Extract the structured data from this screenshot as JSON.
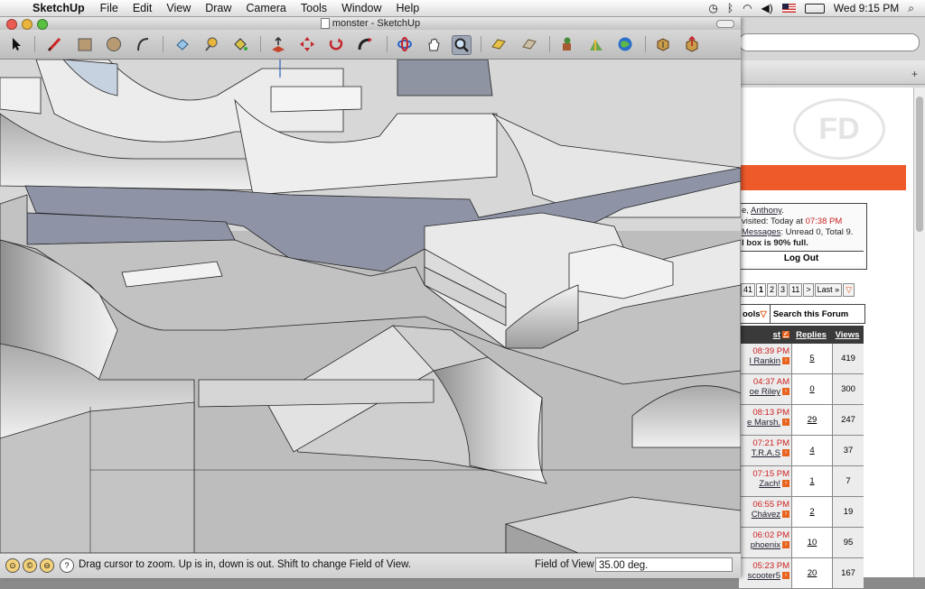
{
  "menubar": {
    "apple_glyph": "",
    "app_name": "SketchUp",
    "menus": [
      "File",
      "Edit",
      "View",
      "Draw",
      "Camera",
      "Tools",
      "Window",
      "Help"
    ],
    "clock": "Wed 9:15 PM"
  },
  "window": {
    "title": "monster - SketchUp"
  },
  "toolbar": {
    "tools": [
      "select-tool",
      "pencil-tool",
      "rectangle-tool",
      "circle-tool",
      "arc-tool",
      "eraser-tool",
      "tape-measure-tool",
      "paint-bucket-tool",
      "push-pull-tool",
      "move-tool",
      "rotate-tool",
      "follow-me-tool",
      "orbit-tool",
      "pan-tool",
      "zoom-tool",
      "section-plane-tool",
      "section-cut-tool",
      "add-location-tool",
      "toggle-terrain-tool",
      "google-earth-tool",
      "get-models-tool",
      "share-model-tool"
    ]
  },
  "statusbar": {
    "hint": "Drag cursor to zoom.  Up is in, down is out. Shift to change Field of View.",
    "fov_label": "Field of View",
    "fov_value": "35.00 deg."
  },
  "forum": {
    "welcome_name": "Anthony",
    "welcome_prefix": "e, ",
    "last_visited_prefix": "visited: Today at ",
    "last_visited_time": "07:38 PM",
    "messages_link": "Messages",
    "messages_info": ": Unread 0, Total 9.",
    "box_full": "l box is 90% full.",
    "logout": "Log Out",
    "pager": [
      "41",
      "1",
      "2",
      "3",
      "11",
      ">",
      "Last »"
    ],
    "tools_label": "ools",
    "search_label": "Search this Forum",
    "col_last": "st",
    "col_replies": "Replies",
    "col_views": "Views",
    "threads": [
      {
        "time": "08:39 PM",
        "user": "l Rankin",
        "replies": "5",
        "views": "419"
      },
      {
        "time": "04:37 AM",
        "user": "oe Riley",
        "replies": "0",
        "views": "300"
      },
      {
        "time": "08:13 PM",
        "user": "e Marsh.",
        "replies": "29",
        "views": "247"
      },
      {
        "time": "07:21 PM",
        "user": "T.R.A.S",
        "replies": "4",
        "views": "37"
      },
      {
        "time": "07:15 PM",
        "user": "Zach!",
        "replies": "1",
        "views": "7"
      },
      {
        "time": "06:55 PM",
        "user": "Chávez",
        "replies": "2",
        "views": "19"
      },
      {
        "time": "06:02 PM",
        "user": "phoenix",
        "replies": "10",
        "views": "95"
      },
      {
        "time": "05:23 PM",
        "user": "scooter5",
        "replies": "20",
        "views": "167"
      }
    ]
  }
}
